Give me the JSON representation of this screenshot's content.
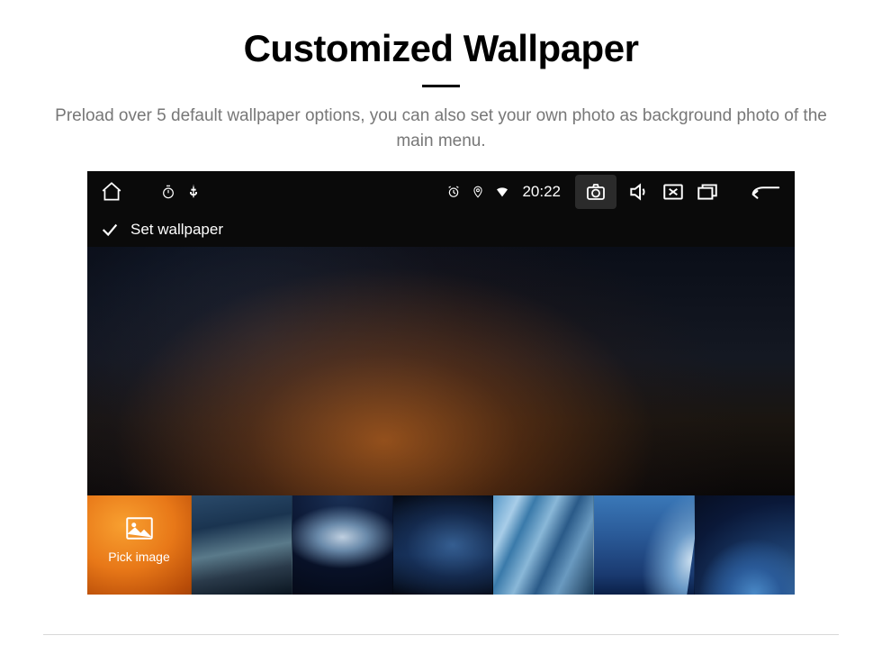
{
  "page": {
    "title": "Customized Wallpaper",
    "subtitle": "Preload over 5 default wallpaper options, you can also set your own photo as background photo of the main menu."
  },
  "statusbar": {
    "time": "20:22"
  },
  "subheader": {
    "label": "Set wallpaper"
  },
  "thumbnails": {
    "pick_label": "Pick image"
  }
}
